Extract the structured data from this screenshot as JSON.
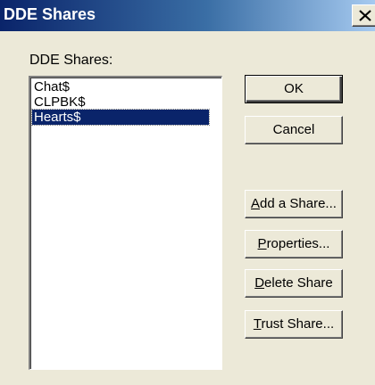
{
  "window": {
    "title": "DDE Shares"
  },
  "icons": {
    "close": "close-icon"
  },
  "shares_label": "DDE Shares:",
  "shares": [
    {
      "name": "Chat$",
      "selected": false
    },
    {
      "name": "CLPBK$",
      "selected": false
    },
    {
      "name": "Hearts$",
      "selected": true
    }
  ],
  "buttons": {
    "ok": "OK",
    "cancel": "Cancel",
    "add_share": {
      "mnemonic": "A",
      "rest": "dd a Share..."
    },
    "properties": {
      "mnemonic": "P",
      "rest": "roperties..."
    },
    "delete_share": {
      "mnemonic": "D",
      "rest": "elete Share"
    },
    "trust_share": {
      "mnemonic": "T",
      "rest": "rust Share..."
    }
  },
  "colors": {
    "face": "#ECE9D8",
    "title_start": "#0A246A",
    "title_end": "#A6CAF0",
    "selection": "#0A246A"
  }
}
